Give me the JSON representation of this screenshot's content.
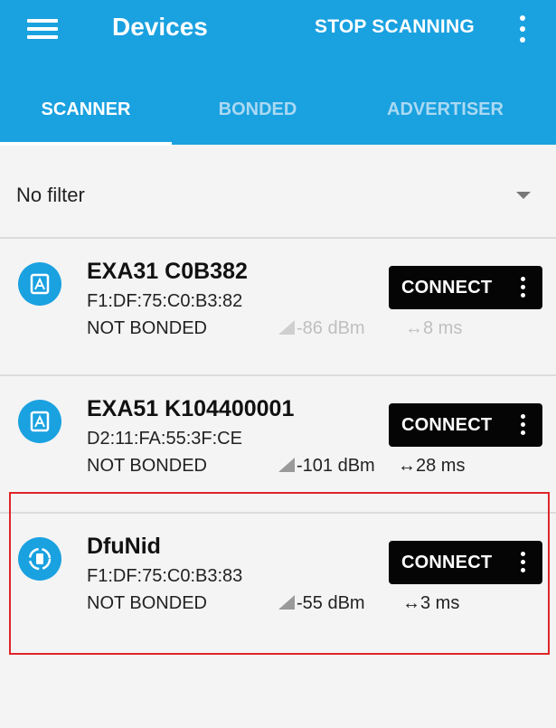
{
  "appbar": {
    "title": "Devices",
    "action_label": "STOP SCANNING",
    "menu_icon": "hamburger-menu-icon",
    "overflow_icon": "more-vertical-icon",
    "color": "#1aa1e0"
  },
  "tabs": [
    {
      "label": "SCANNER",
      "active": true
    },
    {
      "label": "BONDED",
      "active": false
    },
    {
      "label": "ADVERTISER",
      "active": false
    }
  ],
  "filter": {
    "selected": "No filter"
  },
  "devices": [
    {
      "name": "EXA31 C0B382",
      "address": "F1:DF:75:C0:B3:82",
      "bond_state": "NOT BONDED",
      "rssi": "-86 dBm",
      "interval": "↔8 ms",
      "connect_label": "CONNECT",
      "icon": "broadcast-device-icon"
    },
    {
      "name": "EXA51 K104400001",
      "address": "D2:11:FA:55:3F:CE",
      "bond_state": "NOT BONDED",
      "rssi": "-101 dBm",
      "interval": "↔28 ms",
      "connect_label": "CONNECT",
      "icon": "broadcast-device-icon"
    },
    {
      "name": "DfuNid",
      "address": "F1:DF:75:C0:B3:83",
      "bond_state": "NOT BONDED",
      "rssi": "-55 dBm",
      "interval": "↔3 ms",
      "connect_label": "CONNECT",
      "icon": "dfu-device-icon"
    }
  ],
  "highlight_color": "#e0242a"
}
